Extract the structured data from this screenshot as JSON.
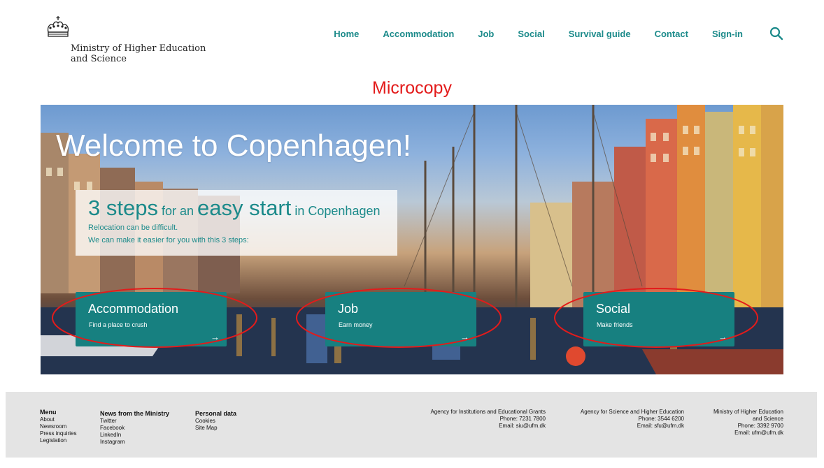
{
  "header": {
    "logo_line1": "Ministry of Higher Education",
    "logo_line2": "and Science",
    "nav": [
      "Home",
      "Accommodation",
      "Job",
      "Social",
      "Survival guide",
      "Contact",
      "Sign-in"
    ],
    "search_icon": "search-icon"
  },
  "annotation_title": "Microcopy",
  "hero": {
    "title": "Welcome to Copenhagen!",
    "steps": {
      "word1": "3 steps",
      "word2": " for an ",
      "word3": "easy start",
      "word4": " in Copenhagen",
      "line1": "Relocation can be difficult.",
      "line2": "We can make it easier for you with this 3 steps:"
    },
    "cards": [
      {
        "title": "Accommodation",
        "sub": "Find a place to crush",
        "arrow": "→"
      },
      {
        "title": "Job",
        "sub": "Earn money",
        "arrow": "→"
      },
      {
        "title": "Social",
        "sub": "Make friends",
        "arrow": "→"
      }
    ]
  },
  "footer": {
    "menu": {
      "title": "Menu",
      "links": [
        "About",
        "Newsroom",
        "Press inquiries",
        "Legislation"
      ]
    },
    "news": {
      "title": "News from the Ministry",
      "links": [
        "Twitter",
        "Facebook",
        "LinkedIn",
        "Instagram"
      ]
    },
    "personal": {
      "title": "Personal data",
      "links": [
        "Cookies",
        "Site Map"
      ]
    },
    "agency1": {
      "name": "Agency for Institutions and Educational Grants",
      "phone": "Phone: 7231 7800",
      "email": "Email: siu@ufm.dk"
    },
    "agency2": {
      "name": "Agency for Science and Higher Education",
      "phone": "Phone: 3544 6200",
      "email": "Email: sfu@ufm.dk"
    },
    "ministry": {
      "name1": "Ministry of Higher Education",
      "name2": "and Science",
      "phone": "Phone: 3392 9700",
      "email": "Email: ufm@ufm.dk"
    }
  },
  "colors": {
    "accent": "#1b8a8a",
    "card": "#178080",
    "annotation": "#e31b1b",
    "footer_bg": "#e4e4e4"
  }
}
